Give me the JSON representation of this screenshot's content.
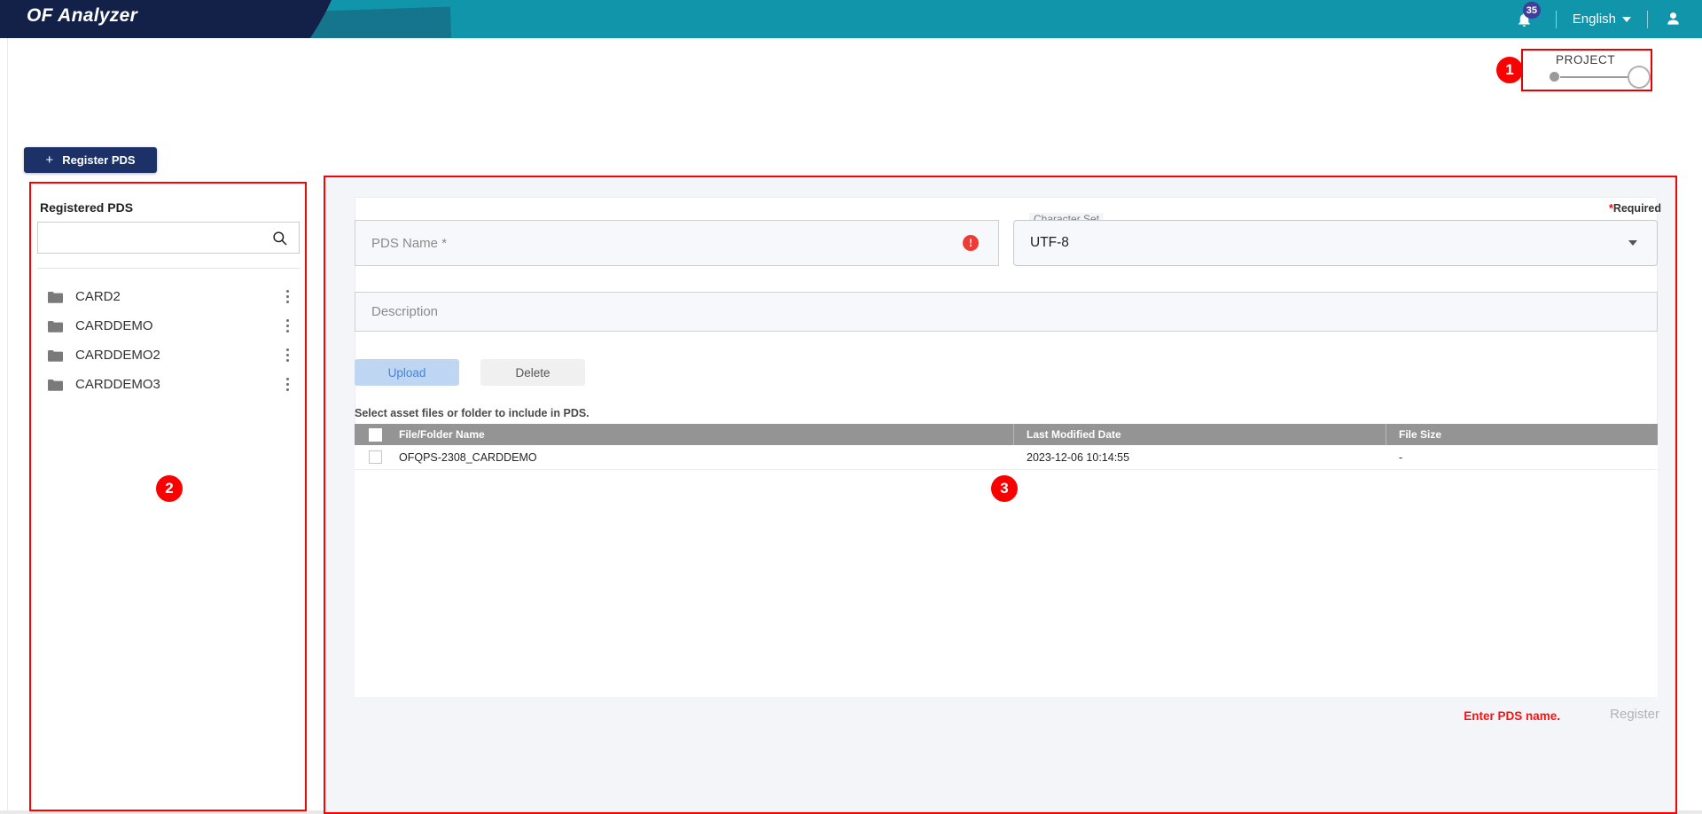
{
  "header": {
    "logo": "OF Analyzer",
    "notification_count": "35",
    "language": "English",
    "icons": {
      "bell": "bell-icon",
      "user": "user-avatar-icon",
      "caret": "chevron-down-icon"
    },
    "colors": {
      "teal": "#1095ab",
      "navy": "#132148",
      "badge_purple": "#3f3d9e"
    }
  },
  "project_toggle": {
    "label": "PROJECT",
    "state": "off",
    "annotation": "1"
  },
  "toolbar": {
    "register_pds_label": "Register PDS",
    "register_pds_plus": "+"
  },
  "sidebar": {
    "title": "Registered PDS",
    "annotation": "2",
    "search": {
      "value": "",
      "placeholder": "",
      "icon": "search-icon"
    },
    "items": [
      {
        "label": "CARD2"
      },
      {
        "label": "CARDDEMO"
      },
      {
        "label": "CARDDEMO2"
      },
      {
        "label": "CARDDEMO3"
      }
    ]
  },
  "main": {
    "annotation": "3",
    "required_note": {
      "star": "*",
      "text": "Required"
    },
    "pds_name": {
      "value": "",
      "placeholder": "PDS Name *",
      "error_icon": "!"
    },
    "character_set": {
      "legend": "Character Set",
      "value": "UTF-8"
    },
    "description": {
      "value": "",
      "placeholder": "Description"
    },
    "buttons": {
      "upload": "Upload",
      "delete": "Delete"
    },
    "hint": "Select asset files or folder to include in PDS.",
    "table": {
      "columns": [
        "File/Folder Name",
        "Last Modified Date",
        "File Size"
      ],
      "rows": [
        {
          "checked": false,
          "name": "OFQPS-2308_CARDDEMO",
          "modified": "2023-12-06 10:14:55",
          "size": "-"
        }
      ]
    },
    "footer": {
      "message": "Enter PDS name.",
      "register_label": "Register"
    }
  },
  "colors": {
    "annotation_red": "#fb0000",
    "outline_red": "#ff0000",
    "primary_navy": "#1b3167",
    "upload_blue": "#bfd6f3",
    "table_header_gray": "#949494"
  }
}
